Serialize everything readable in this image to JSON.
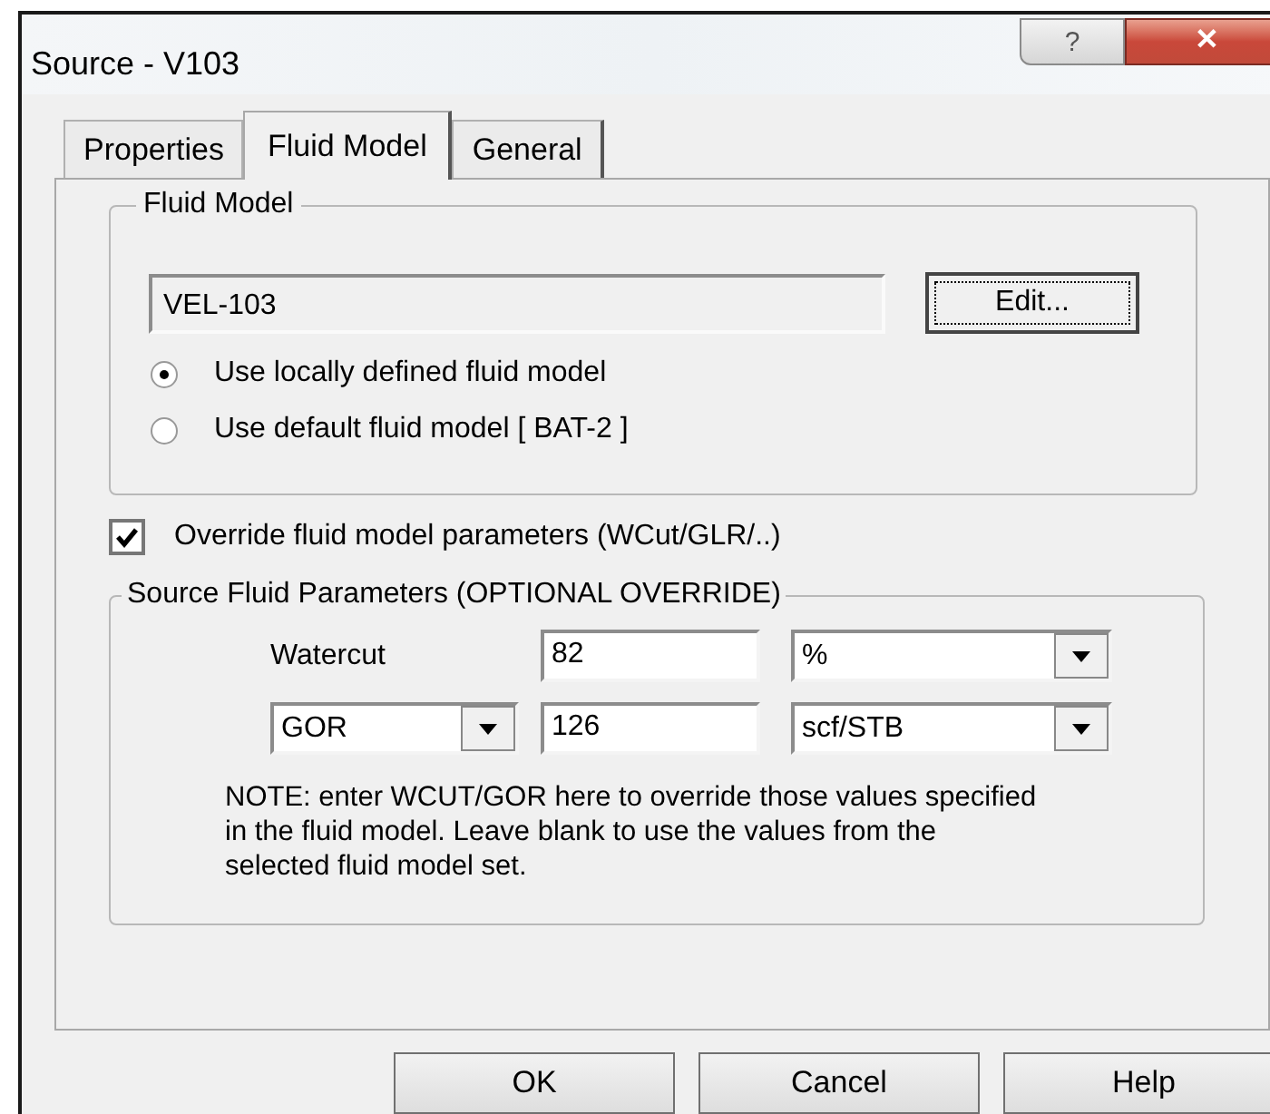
{
  "window": {
    "title": "Source - V103",
    "title_buttons": [
      "?",
      "✕"
    ]
  },
  "tabs": [
    {
      "label": "Properties",
      "selected": false
    },
    {
      "label": "Fluid Model",
      "selected": true
    },
    {
      "label": "General",
      "selected": false
    }
  ],
  "fluid_model_group": {
    "title": "Fluid Model",
    "model_field": {
      "value": "VEL-103"
    },
    "edit_button": "Edit...",
    "options": [
      {
        "label": "Use locally defined fluid model",
        "selected": true
      },
      {
        "label": "Use default fluid model [ BAT-2 ]",
        "selected": false
      }
    ]
  },
  "override": {
    "label": "Override fluid model parameters (WCut/GLR/..)",
    "checked": true
  },
  "parameters_group": {
    "title": "Source Fluid Parameters (OPTIONAL OVERRIDE)",
    "watercut": {
      "label": "Watercut",
      "value": "82",
      "unit": "%"
    },
    "gas_ratio": {
      "type": "GOR",
      "value": "126",
      "unit": "scf/STB"
    },
    "note": "NOTE: enter WCUT/GOR here to override those values specified in the fluid model. Leave blank to use the values from the selected fluid model set."
  },
  "buttons": [
    "OK",
    "Cancel",
    "Help"
  ]
}
